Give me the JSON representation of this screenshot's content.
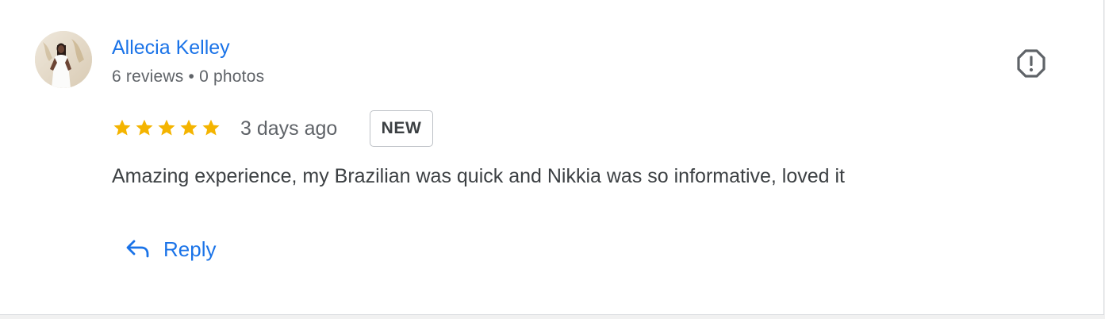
{
  "review": {
    "reviewer": {
      "name": "Allecia Kelley",
      "meta": "6 reviews • 0 photos",
      "avatar": "avatar-photo"
    },
    "rating": 5,
    "rating_color": "#f4b400",
    "time": "3 days ago",
    "badge": "NEW",
    "text": "Amazing experience, my Brazilian was quick and Nikkia was so informative, loved it",
    "flag_icon": "report-icon",
    "reply": {
      "label": "Reply",
      "icon": "reply-arrow-icon"
    },
    "accent_color": "#1a73e8"
  }
}
